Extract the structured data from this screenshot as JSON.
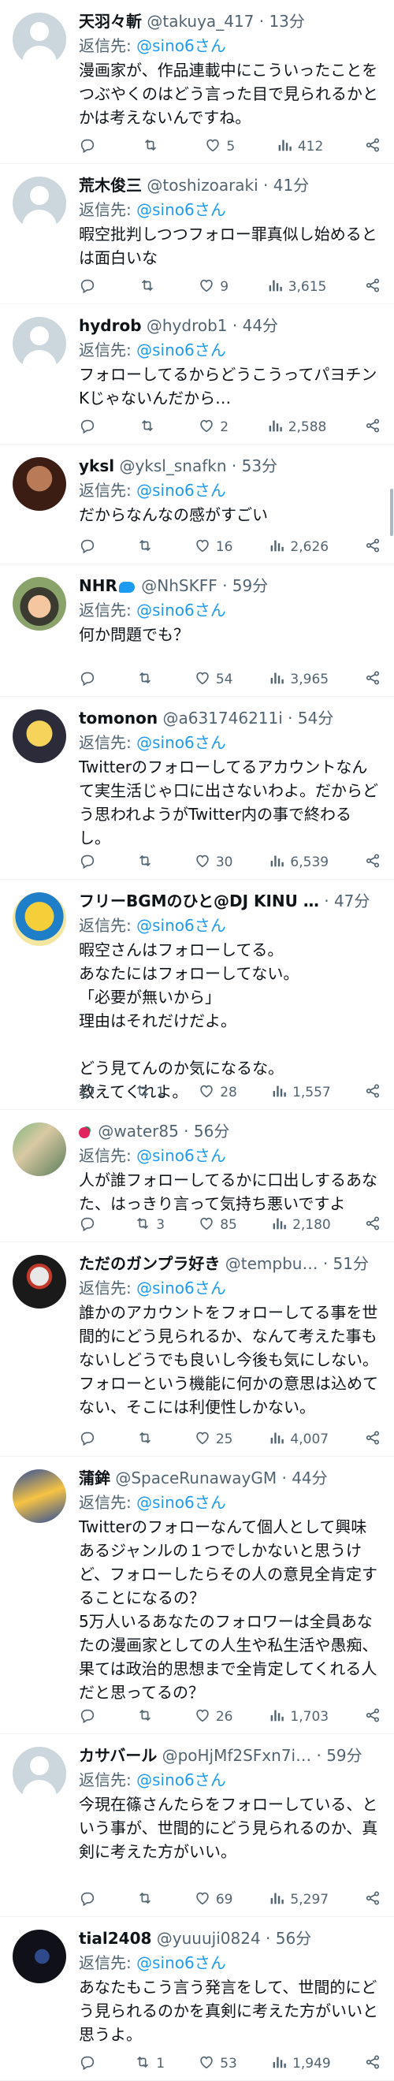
{
  "icons": {
    "reply": "reply-icon",
    "retweet": "retweet-icon",
    "like": "heart-icon",
    "views": "views-bar-chart-icon",
    "share": "share-icon"
  },
  "reply_prefix": "返信先:",
  "tweets": [
    {
      "name": "天羽々斬",
      "handle": "@takuya_417",
      "time": "13分",
      "reply_to": "@sino6さん",
      "text": "漫画家が、作品連載中にこういったことを\nつぶやくのはどう言った目で見られるかと\nかは考えないんですね。",
      "replies": "",
      "retweets": "",
      "likes": "5",
      "views": "412",
      "avatar": "default"
    },
    {
      "name": "荒木俊三",
      "handle": "@toshizoaraki",
      "time": "41分",
      "reply_to": "@sino6さん",
      "text": "暇空批判しつつフォロー罪真似し始めると\nは面白いな",
      "replies": "",
      "retweets": "",
      "likes": "9",
      "views": "3,615",
      "avatar": "default"
    },
    {
      "name": "hydrob",
      "handle": "@hydrob1",
      "time": "44分",
      "reply_to": "@sino6さん",
      "text": "フォローしてるからどうこうってパヨチン\nKじゃないんだから…",
      "replies": "",
      "retweets": "",
      "likes": "2",
      "views": "2,588",
      "avatar": "default"
    },
    {
      "name": "yksl",
      "handle": "@yksl_snafkn",
      "time": "53分",
      "reply_to": "@sino6さん",
      "text": "だからなんなの感がすごい",
      "replies": "",
      "retweets": "",
      "likes": "16",
      "views": "2,626",
      "avatar": "yksl"
    },
    {
      "name": "NHR",
      "handle": "@NhSKFF",
      "time": "59分",
      "reply_to": "@sino6さん",
      "text": "何か問題でも？",
      "replies": "",
      "retweets": "",
      "likes": "54",
      "views": "3,965",
      "avatar": "nhr",
      "badge": true
    },
    {
      "name": "tomonon",
      "handle": "@a631746211i",
      "time": "54分",
      "reply_to": "@sino6さん",
      "text": "Twitterのフォローしてるアカウントなん\nて実生活じゃ口に出さないわよ。だからど\nう思われようがTwitter内の事で終わる\nし。",
      "replies": "",
      "retweets": "",
      "likes": "30",
      "views": "6,539",
      "avatar": "tomonon"
    },
    {
      "name": "フリーBGMのひと@DJ KINU …",
      "handle": "",
      "time": "47分",
      "reply_to": "@sino6さん",
      "text": "暇空さんはフォローしてる。\nあなたにはフォローしてない。\n「必要が無いから」\n理由はそれだけだよ。\n\nどう見てんのか気になるな。\n教えてくれよ。",
      "replies": "",
      "retweets": "1",
      "likes": "28",
      "views": "1,557",
      "avatar": "bgm"
    },
    {
      "name": "",
      "handle": "@water85",
      "time": "56分",
      "reply_to": "@sino6さん",
      "text": "人が誰フォローしてるかに口出しするあな\nた、はっきり言って気持ち悪いですよ",
      "replies": "",
      "retweets": "3",
      "likes": "85",
      "views": "2,180",
      "avatar": "water",
      "leaf": true
    },
    {
      "name": "ただのガンプラ好き",
      "handle": "@tempbu…",
      "time": "51分",
      "reply_to": "@sino6さん",
      "text": "誰かのアカウントをフォローしてる事を世\n間的にどう見られるか、なんて考えた事も\nないしどうでも良いし今後も気にしない。\nフォローという機能に何かの意思は込めて\nない、そこには利便性しかない。",
      "replies": "",
      "retweets": "",
      "likes": "25",
      "views": "4,007",
      "avatar": "gunpla"
    },
    {
      "name": "蒲鉾",
      "handle": "@SpaceRunawayGM",
      "time": "44分",
      "reply_to": "@sino6さん",
      "text": "Twitterのフォローなんて個人として興味\nあるジャンルの１つでしかないと思うけ\nど、フォローしたらその人の意見全肯定す\nることになるの？\n5万人いるあなたのフォロワーは全員あな\nたの漫画家としての人生や私生活や愚痴、\n果ては政治的思想まで全肯定してくれる人\nだと思ってるの？",
      "replies": "",
      "retweets": "",
      "likes": "26",
      "views": "1,703",
      "avatar": "space"
    },
    {
      "name": "カサバール",
      "handle": "@poHjMf2SFxn7i…",
      "time": "59分",
      "reply_to": "@sino6さん",
      "text": "今現在篠さんたらをフォローしている、と\nいう事が、世間的にどう見られるのか、真\n剣に考えた方がいい。",
      "replies": "",
      "retweets": "",
      "likes": "69",
      "views": "5,297",
      "avatar": "default"
    },
    {
      "name": "tial2408",
      "handle": "@yuuuji0824",
      "time": "56分",
      "reply_to": "@sino6さん",
      "text": "あなたもこう言う発言をして、世間的にど\nう見られるのかを真剣に考えた方がいいと\n思うよ。",
      "replies": "",
      "retweets": "1",
      "likes": "53",
      "views": "1,949",
      "avatar": "tial"
    }
  ]
}
